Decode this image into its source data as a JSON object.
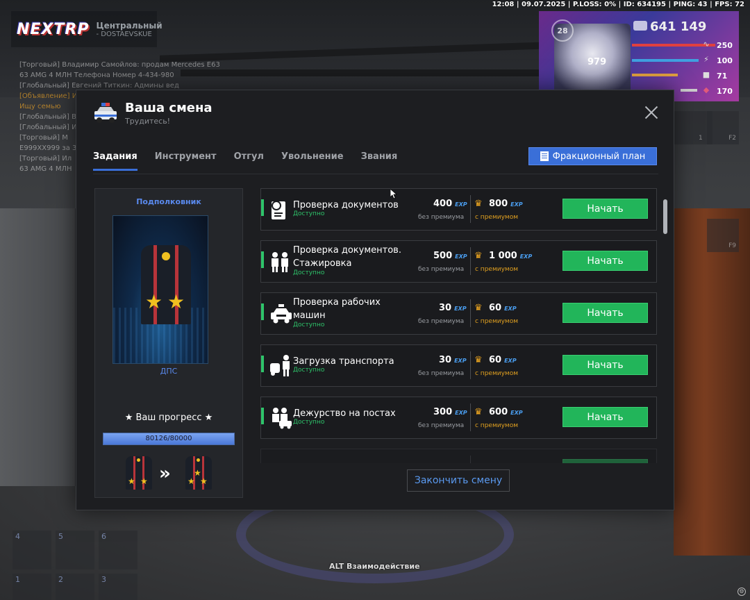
{
  "hud": {
    "stats": "12:08 | 09.07.2025 | P.LOSS: 0% | ID: 634195 | PING: 43 | FPS: 72",
    "logo": "NEXTRP",
    "district": "Центральный",
    "street": "- DOSTAEVSKUE",
    "money": "641 149",
    "level": "28",
    "hp_value": "979",
    "health": "250",
    "armor": "100",
    "hunger": "71",
    "wanted": "170",
    "interact_hint": "ALT Взаимодействие",
    "hotbar": [
      "4",
      "5",
      "6",
      "1",
      "2",
      "3"
    ],
    "side_keys": [
      "F2",
      "F9"
    ],
    "side_count": "1"
  },
  "chat": [
    {
      "text": "[Торговый] Владимир Самойлов: продам Mercedes E63",
      "color": "#ddd"
    },
    {
      "text": "63 AMG 4 МЛН Телефона Номер 4-434-980",
      "color": "#ddd"
    },
    {
      "text": "[Глобальный] Евгений Титкин: Админы вед",
      "color": "#ddd"
    },
    {
      "text": "[Объявление] Ищу семью",
      "color": "#e6a028"
    },
    {
      "text": "Ищу семью",
      "color": "#e6a028"
    },
    {
      "text": "[Глобальный] В",
      "color": "#ddd"
    },
    {
      "text": "[Глобальный] И",
      "color": "#ddd"
    },
    {
      "text": "[Торговый] М",
      "color": "#ddd"
    },
    {
      "text": "E999XX999 за 3",
      "color": "#ddd"
    },
    {
      "text": "[Торговый] Ил",
      "color": "#ddd"
    },
    {
      "text": "63 AMG 4 МЛН",
      "color": "#ddd"
    }
  ],
  "modal": {
    "title": "Ваша смена",
    "subtitle": "Трудитесь!",
    "tabs": [
      "Задания",
      "Инструмент",
      "Отгул",
      "Увольнение",
      "Звания"
    ],
    "faction_plan": "Фракционный план",
    "end_shift": "Закончить смену"
  },
  "rank": {
    "name": "Подполковник",
    "department": "ДПС",
    "progress_title": "★ Ваш прогресс ★",
    "progress_text": "80126/80000",
    "progress_fraction": 1.0
  },
  "tasks": [
    {
      "icon": "passport-icon",
      "name": "Проверка документов",
      "status": "Доступно",
      "exp": "400",
      "exp_premium": "800",
      "lbl_no_prem": "без премиума",
      "lbl_prem": "с премиумом",
      "exp_tag": "EXP",
      "button": "Начать"
    },
    {
      "icon": "officers-icon",
      "name": "Проверка документов. Стажировка",
      "status": "Доступно",
      "exp": "500",
      "exp_premium": "1 000",
      "lbl_no_prem": "без премиума",
      "lbl_prem": "с премиумом",
      "exp_tag": "EXP",
      "button": "Начать"
    },
    {
      "icon": "police-car-icon",
      "name": "Проверка рабочих машин",
      "status": "Доступно",
      "exp": "30",
      "exp_premium": "60",
      "lbl_no_prem": "без премиума",
      "lbl_prem": "с премиумом",
      "exp_tag": "EXP",
      "button": "Начать"
    },
    {
      "icon": "tow-officer-icon",
      "name": "Загрузка транспорта",
      "status": "Доступно",
      "exp": "30",
      "exp_premium": "60",
      "lbl_no_prem": "без премиума",
      "lbl_prem": "с премиумом",
      "exp_tag": "EXP",
      "button": "Начать"
    },
    {
      "icon": "patrol-post-icon",
      "name": "Дежурство на постах",
      "status": "Доступно",
      "exp": "300",
      "exp_premium": "600",
      "lbl_no_prem": "без премиума",
      "lbl_prem": "с премиумом",
      "exp_tag": "EXP",
      "button": "Начать"
    }
  ],
  "colors": {
    "accent": "#3a6fd8",
    "start_button": "#22b55a",
    "available": "#2ec46a",
    "premium": "#e0a020",
    "exp_tag": "#4a9ef0"
  }
}
